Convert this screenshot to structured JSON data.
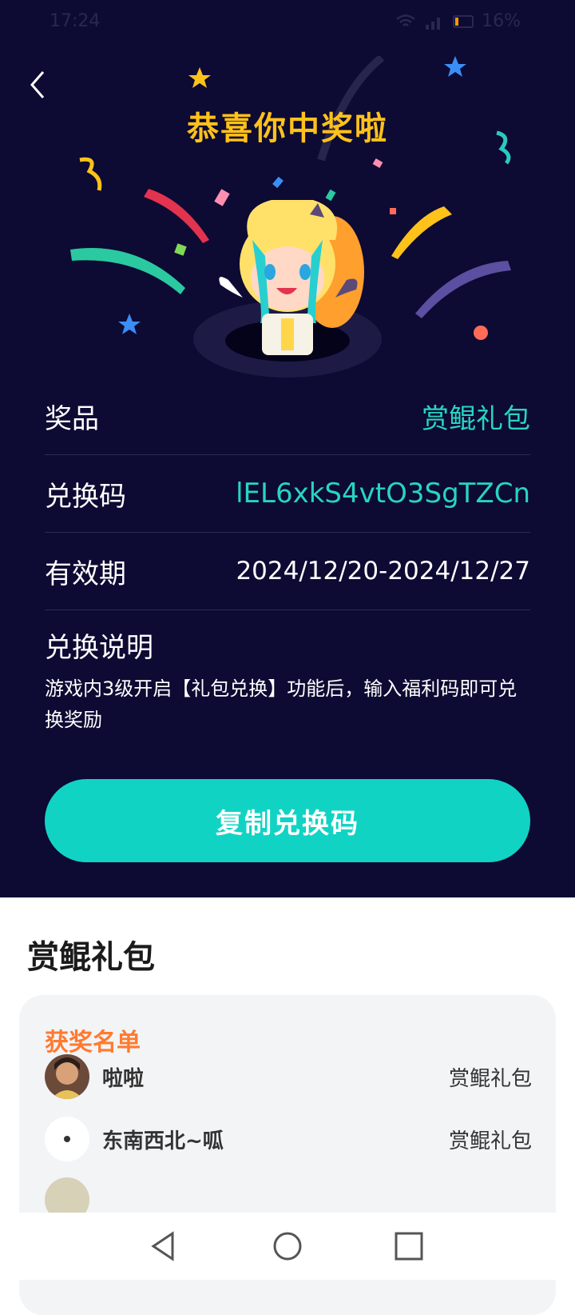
{
  "status_bar": {
    "time": "17:24",
    "battery": "16%"
  },
  "header": {
    "title": "恭喜你中奖啦"
  },
  "details": {
    "prize_label": "奖品",
    "prize_value": "赏鲲礼包",
    "code_label": "兑换码",
    "code_value": "lEL6xkS4vtO3SgTZCn",
    "validity_label": "有效期",
    "validity_value": "2024/12/20-2024/12/27",
    "instructions_title": "兑换说明",
    "instructions_text": "游戏内3级开启【礼包兑换】功能后，输入福利码即可兑换奖励"
  },
  "copy_button": {
    "label": "复制兑换码"
  },
  "package": {
    "title": "赏鲲礼包"
  },
  "winners": {
    "title": "获奖名单",
    "items": [
      {
        "name": "啦啦",
        "prize": "赏鲲礼包"
      },
      {
        "name": "东南西北~呱",
        "prize": "赏鲲礼包"
      }
    ]
  },
  "colors": {
    "background_dark": "#0d0a33",
    "accent_teal": "#11d3c4",
    "title_gold": "#ffc21a",
    "winners_orange": "#ff7a2f"
  },
  "icons": [
    "back-icon",
    "signal-icon",
    "wifi-icon",
    "battery-icon",
    "nav-back-icon",
    "nav-home-icon",
    "nav-recents-icon"
  ]
}
